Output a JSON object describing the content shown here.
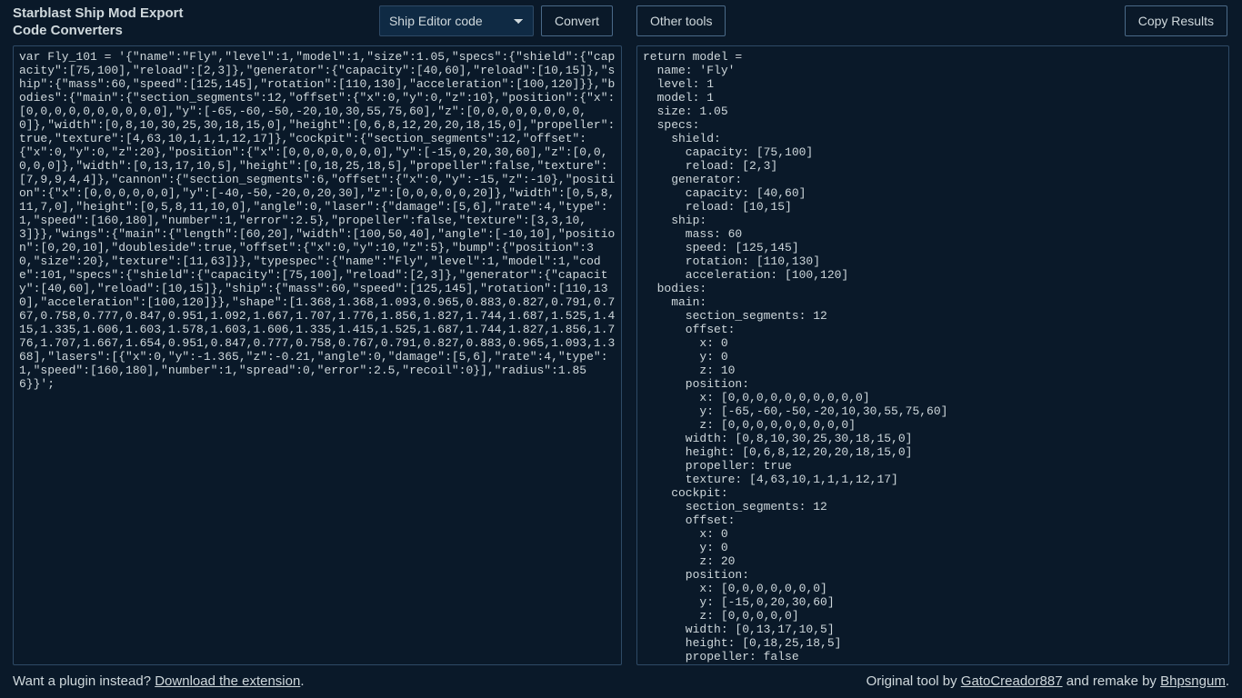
{
  "header": {
    "title_line1": "Starblast Ship Mod Export",
    "title_line2": "Code Converters",
    "dropdown_selected": "Ship Editor code",
    "convert_label": "Convert",
    "other_tools_label": "Other tools",
    "copy_results_label": "Copy Results"
  },
  "input_code": "var Fly_101 = '{\"name\":\"Fly\",\"level\":1,\"model\":1,\"size\":1.05,\"specs\":{\"shield\":{\"capacity\":[75,100],\"reload\":[2,3]},\"generator\":{\"capacity\":[40,60],\"reload\":[10,15]},\"ship\":{\"mass\":60,\"speed\":[125,145],\"rotation\":[110,130],\"acceleration\":[100,120]}},\"bodies\":{\"main\":{\"section_segments\":12,\"offset\":{\"x\":0,\"y\":0,\"z\":10},\"position\":{\"x\":[0,0,0,0,0,0,0,0,0,0],\"y\":[-65,-60,-50,-20,10,30,55,75,60],\"z\":[0,0,0,0,0,0,0,0,0]},\"width\":[0,8,10,30,25,30,18,15,0],\"height\":[0,6,8,12,20,20,18,15,0],\"propeller\":true,\"texture\":[4,63,10,1,1,1,12,17]},\"cockpit\":{\"section_segments\":12,\"offset\":{\"x\":0,\"y\":0,\"z\":20},\"position\":{\"x\":[0,0,0,0,0,0,0],\"y\":[-15,0,20,30,60],\"z\":[0,0,0,0,0]},\"width\":[0,13,17,10,5],\"height\":[0,18,25,18,5],\"propeller\":false,\"texture\":[7,9,9,4,4]},\"cannon\":{\"section_segments\":6,\"offset\":{\"x\":0,\"y\":-15,\"z\":-10},\"position\":{\"x\":[0,0,0,0,0,0],\"y\":[-40,-50,-20,0,20,30],\"z\":[0,0,0,0,0,20]},\"width\":[0,5,8,11,7,0],\"height\":[0,5,8,11,10,0],\"angle\":0,\"laser\":{\"damage\":[5,6],\"rate\":4,\"type\":1,\"speed\":[160,180],\"number\":1,\"error\":2.5},\"propeller\":false,\"texture\":[3,3,10,3]}},\"wings\":{\"main\":{\"length\":[60,20],\"width\":[100,50,40],\"angle\":[-10,10],\"position\":[0,20,10],\"doubleside\":true,\"offset\":{\"x\":0,\"y\":10,\"z\":5},\"bump\":{\"position\":30,\"size\":20},\"texture\":[11,63]}},\"typespec\":{\"name\":\"Fly\",\"level\":1,\"model\":1,\"code\":101,\"specs\":{\"shield\":{\"capacity\":[75,100],\"reload\":[2,3]},\"generator\":{\"capacity\":[40,60],\"reload\":[10,15]},\"ship\":{\"mass\":60,\"speed\":[125,145],\"rotation\":[110,130],\"acceleration\":[100,120]}},\"shape\":[1.368,1.368,1.093,0.965,0.883,0.827,0.791,0.767,0.758,0.777,0.847,0.951,1.092,1.667,1.707,1.776,1.856,1.827,1.744,1.687,1.525,1.415,1.335,1.606,1.603,1.578,1.603,1.606,1.335,1.415,1.525,1.687,1.744,1.827,1.856,1.776,1.707,1.667,1.654,0.951,0.847,0.777,0.758,0.767,0.791,0.827,0.883,0.965,1.093,1.368],\"lasers\":[{\"x\":0,\"y\":-1.365,\"z\":-0.21,\"angle\":0,\"damage\":[5,6],\"rate\":4,\"type\":1,\"speed\":[160,180],\"number\":1,\"spread\":0,\"error\":2.5,\"recoil\":0}],\"radius\":1.856}}';",
  "output_code": "return model =\n  name: 'Fly'\n  level: 1\n  model: 1\n  size: 1.05\n  specs:\n    shield:\n      capacity: [75,100]\n      reload: [2,3]\n    generator:\n      capacity: [40,60]\n      reload: [10,15]\n    ship:\n      mass: 60\n      speed: [125,145]\n      rotation: [110,130]\n      acceleration: [100,120]\n  bodies:\n    main:\n      section_segments: 12\n      offset:\n        x: 0\n        y: 0\n        z: 10\n      position:\n        x: [0,0,0,0,0,0,0,0,0,0]\n        y: [-65,-60,-50,-20,10,30,55,75,60]\n        z: [0,0,0,0,0,0,0,0,0]\n      width: [0,8,10,30,25,30,18,15,0]\n      height: [0,6,8,12,20,20,18,15,0]\n      propeller: true\n      texture: [4,63,10,1,1,1,12,17]\n    cockpit:\n      section_segments: 12\n      offset:\n        x: 0\n        y: 0\n        z: 20\n      position:\n        x: [0,0,0,0,0,0,0]\n        y: [-15,0,20,30,60]\n        z: [0,0,0,0,0]\n      width: [0,13,17,10,5]\n      height: [0,18,25,18,5]\n      propeller: false",
  "footer": {
    "left_prefix": "Want a plugin instead? ",
    "left_link": "Download the extension",
    "left_suffix": ".",
    "right_prefix": "Original tool by ",
    "right_link1": "GatoCreador887",
    "right_mid": " and remake by ",
    "right_link2": "Bhpsngum",
    "right_suffix": "."
  }
}
